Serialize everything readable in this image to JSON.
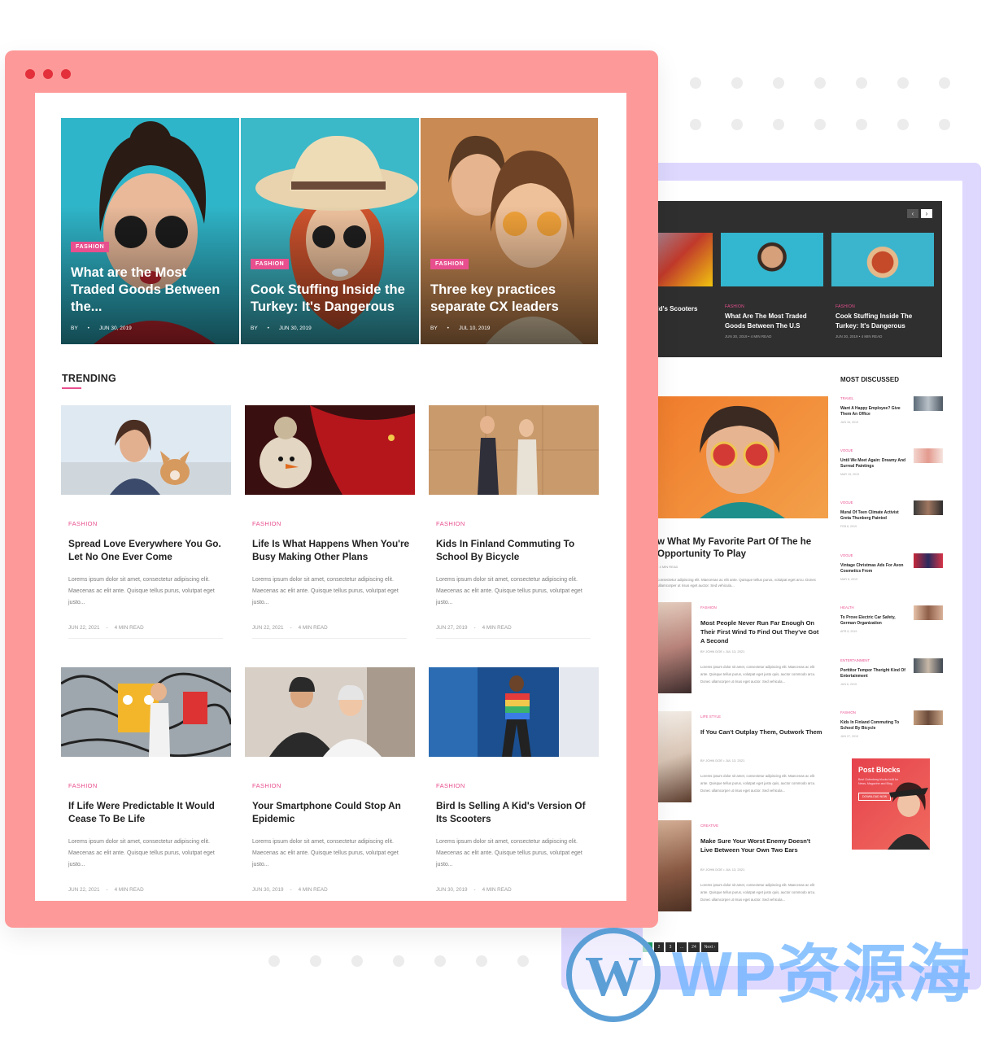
{
  "front": {
    "heroes": [
      {
        "category": "FASHION",
        "title": "What are the Most Traded Goods Between the...",
        "by": "BY",
        "date": "JUN 30, 2019"
      },
      {
        "category": "FASHION",
        "title": "Cook Stuffing Inside the Turkey: It's Dangerous",
        "by": "BY",
        "date": "JUN 30, 2019"
      },
      {
        "category": "FASHION",
        "title": "Three key practices separate CX leaders",
        "by": "BY",
        "date": "JUL 10, 2019"
      }
    ],
    "trending_title": "TRENDING",
    "cards": [
      {
        "category": "FASHION",
        "title": "Spread Love Everywhere You Go. Let No One Ever Come",
        "excerpt": "Lorems ipsum dolor sit amet, consectetur adipiscing elit. Maecenas ac elit ante. Quisque tellus purus, volutpat eget justo...",
        "date": "JUN 22, 2021",
        "read": "4 MIN READ"
      },
      {
        "category": "FASHION",
        "title": "Life Is What Happens When You're Busy Making Other Plans",
        "excerpt": "Lorems ipsum dolor sit amet, consectetur adipiscing elit. Maecenas ac elit ante. Quisque tellus purus, volutpat eget justo...",
        "date": "JUN 22, 2021",
        "read": "4 MIN READ"
      },
      {
        "category": "FASHION",
        "title": "Kids In Finland Commuting To School By Bicycle",
        "excerpt": "Lorems ipsum dolor sit amet, consectetur adipiscing elit. Maecenas ac elit ante. Quisque tellus purus, volutpat eget justo...",
        "date": "JUN 27, 2019",
        "read": "4 MIN READ"
      },
      {
        "category": "FASHION",
        "title": "If Life Were Predictable It Would Cease To Be Life",
        "excerpt": "Lorems ipsum dolor sit amet, consectetur adipiscing elit. Maecenas ac elit ante. Quisque tellus purus, volutpat eget justo...",
        "date": "JUN 22, 2021",
        "read": "4 MIN READ"
      },
      {
        "category": "FASHION",
        "title": "Your Smartphone Could Stop An Epidemic",
        "excerpt": "Lorems ipsum dolor sit amet, consectetur adipiscing elit. Maecenas ac elit ante. Quisque tellus purus, volutpat eget justo...",
        "date": "JUN 30, 2019",
        "read": "4 MIN READ"
      },
      {
        "category": "FASHION",
        "title": "Bird Is Selling A Kid's Version Of Its Scooters",
        "excerpt": "Lorems ipsum dolor sit amet, consectetur adipiscing elit. Maecenas ac elit ante. Quisque tellus purus, volutpat eget justo...",
        "date": "JUN 30, 2019",
        "read": "4 MIN READ"
      }
    ]
  },
  "back": {
    "slider_prev": "‹",
    "slider_next": "›",
    "slides": [
      {
        "category": "",
        "title": "A Kid's Scooters",
        "meta": "READ"
      },
      {
        "category": "FASHION",
        "title": "What Are The Most Traded Goods Between The U.S",
        "meta": "JUN 30, 2019  •  4 MIN READ"
      },
      {
        "category": "FASHION",
        "title": "Cook Stuffing Inside The Turkey: It's Dangerous",
        "meta": "JUN 30, 2019  •  4 MIN READ"
      }
    ],
    "feature": {
      "title": "w What My Favorite Part Of The he Opportunity To Play",
      "meta": "•  4 MIN READ",
      "excerpt": "consectetur adipiscing elit. Maecenas ac elit ante. Quisque tellus purus, volutpat eget arcu. Donec ullamcorper ut risus eget auctor. Sed vehicula..."
    },
    "posts": [
      {
        "category": "FASHION",
        "title": "Most People Never Run Far Enough On Their First Wind To Find Out They've Got A Second",
        "meta": "BY JOHN DOE  •  JUL 13, 2021",
        "excerpt": "Lorems ipsum dolor sit amet, consectetur adipiscing elit. Maecenas ac elit ante. Quisque tellus purus, volutpat eget justo quis, auctor commodo arcu. Donec ullamcorper ut risus eget auctor. Sed vehicula..."
      },
      {
        "category": "LIFE STYLE",
        "title": "If You Can't Outplay Them, Outwork Them",
        "meta": "BY JOHN DOE  •  JUL 13, 2021",
        "excerpt": "Lorems ipsum dolor sit amet, consectetur adipiscing elit. Maecenas ac elit ante. Quisque tellus purus, volutpat eget justo quis, auctor commodo arcu. Donec ullamcorper ut risus eget auctor. Sed vehicula..."
      },
      {
        "category": "CREATIVE",
        "title": "Make Sure Your Worst Enemy Doesn't Live Between Your Own Two Ears",
        "meta": "BY JOHN DOE  •  JUL 13, 2021",
        "excerpt": "Lorems ipsum dolor sit amet, consectetur adipiscing elit. Maecenas ac elit ante. Quisque tellus purus, volutpat eget justo quis, auctor commodo arcu. Donec ullamcorper ut risus eget auctor. Sed vehicula..."
      }
    ],
    "sidebar_title": "MOST DISCUSSED",
    "sidebar": [
      {
        "category": "TRAVEL",
        "title": "Want A Happy Employee? Give Them An Office",
        "date": "JUN 16, 2019"
      },
      {
        "category": "VOGUE",
        "title": "Until We Meet Again: Dreamy And Surreal Paintings",
        "date": "MAR 15, 2019"
      },
      {
        "category": "VOGUE",
        "title": "Mural Of Teen Climate Activist Greta Thunberg Painted",
        "date": "FEB 8, 2019"
      },
      {
        "category": "VOGUE",
        "title": "Vintage Christmas Ads For Avon Cosmetics From",
        "date": "MAR 8, 2019"
      },
      {
        "category": "HEALTH",
        "title": "To Prove Electric Car Safety, German Organization",
        "date": "APR 8, 2019"
      },
      {
        "category": "ENTERTAINMENT",
        "title": "Porttitor Tempor Theright Kind Of Entertainment",
        "date": "JUN 6, 2019"
      },
      {
        "category": "FASHION",
        "title": "Kids In Finland Commuting To School By Bicycle",
        "date": "JUN 27, 2019"
      }
    ],
    "ad": {
      "title": "Post Blocks",
      "subtitle": "Best Gutenberg blocks built for News, Magazine and Blog",
      "button": "DOWNLOAD NOW"
    },
    "pager": [
      "1",
      "2",
      "3",
      "...",
      "24",
      "Next ›"
    ]
  },
  "watermark": "WP资源海",
  "colors": {
    "accent": "#e84f8e",
    "frame_front": "#fd9a99",
    "frame_back": "#ded8ff",
    "window_dot": "#e3303a"
  }
}
